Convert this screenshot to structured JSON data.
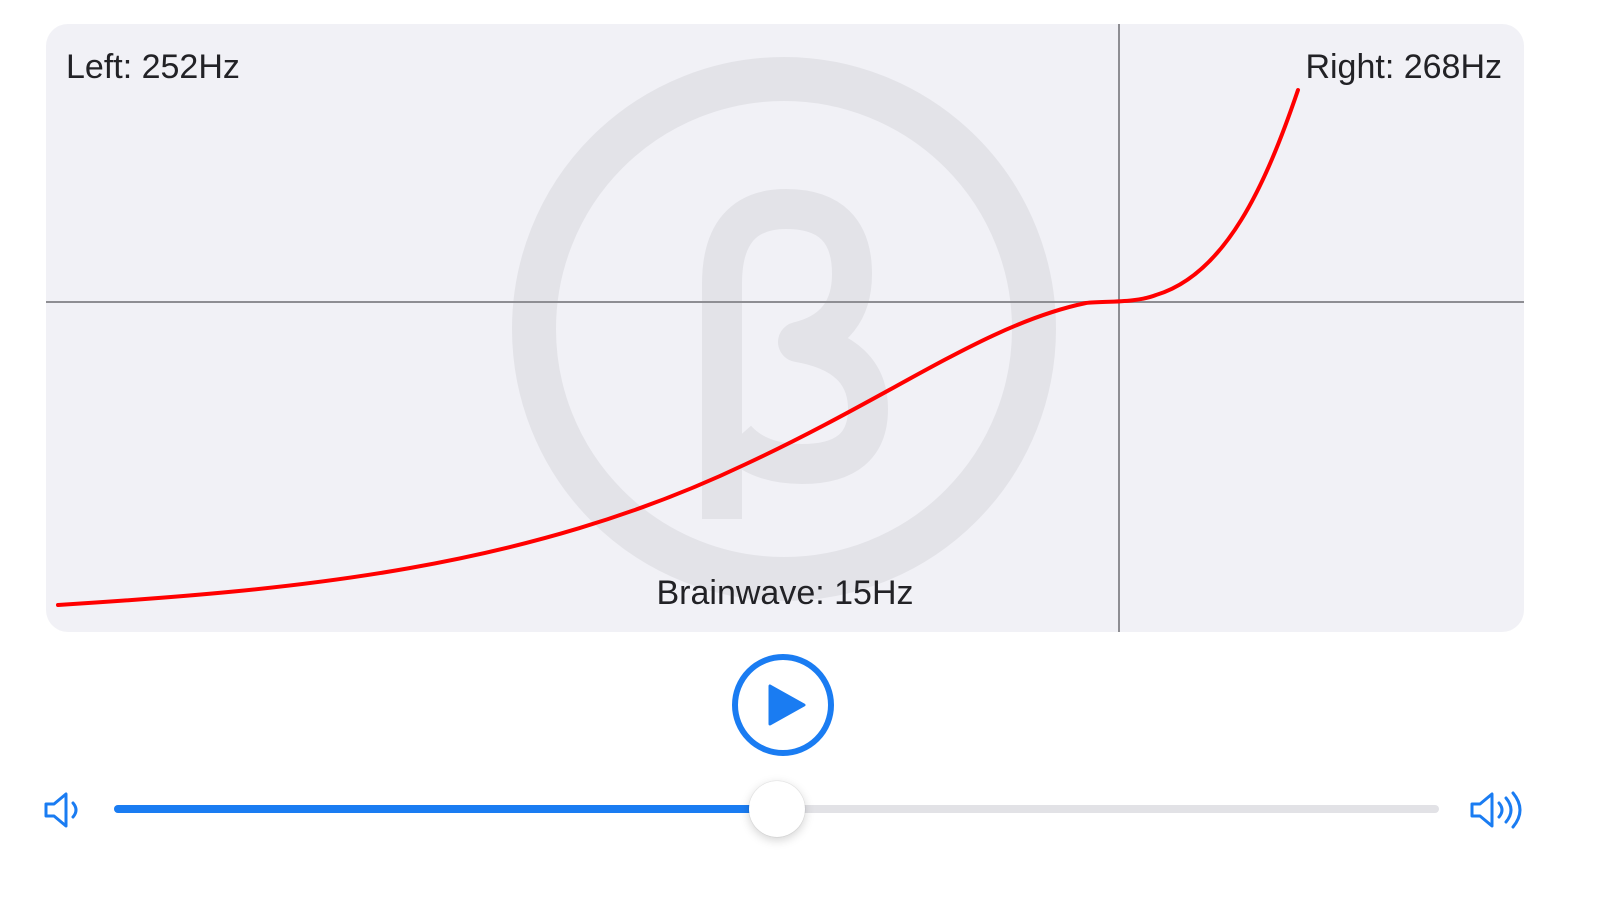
{
  "graph": {
    "left_label": "Left: 252Hz",
    "right_label": "Right: 268Hz",
    "brainwave_label": "Brainwave: 15Hz",
    "watermark_symbol": "β",
    "curve_color": "#ff0000",
    "axis_color": "#8e8e93"
  },
  "controls": {
    "play_icon": "play-icon",
    "accent_color": "#1a7cf2"
  },
  "volume": {
    "low_icon": "speaker-low-icon",
    "high_icon": "speaker-high-icon",
    "level": 0.5
  }
}
